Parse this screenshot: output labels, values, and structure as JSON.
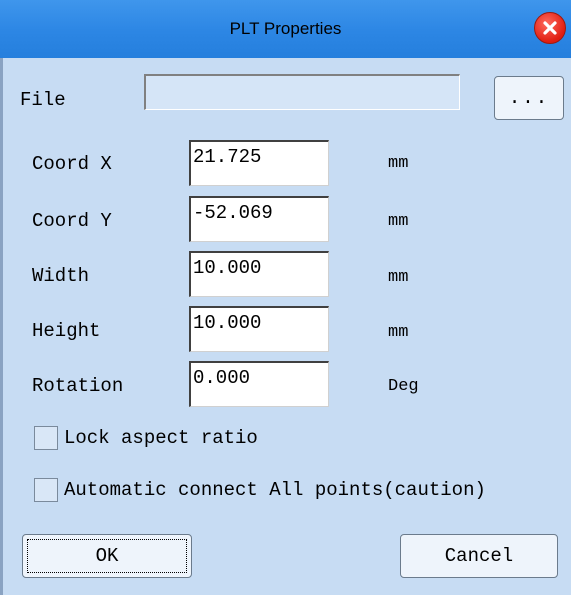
{
  "window": {
    "title": "PLT Properties",
    "close_icon": "close-icon",
    "accent_color": "#2c86e4",
    "background_color": "#c7dcf3"
  },
  "file": {
    "label": "File",
    "value": "",
    "browse_label": "..."
  },
  "fields": {
    "coord_x": {
      "label": "Coord X",
      "value": "21.725",
      "unit": "mm"
    },
    "coord_y": {
      "label": "Coord Y",
      "value": "-52.069",
      "unit": "mm"
    },
    "width": {
      "label": "Width",
      "value": "10.000",
      "unit": "mm"
    },
    "height": {
      "label": "Height",
      "value": "10.000",
      "unit": "mm"
    },
    "rotation": {
      "label": "Rotation",
      "value": "0.000",
      "unit": "Deg"
    }
  },
  "options": {
    "lock_aspect": {
      "label": "Lock aspect ratio",
      "checked": false
    },
    "auto_connect": {
      "label": "Automatic connect All points(caution)",
      "checked": false
    }
  },
  "buttons": {
    "ok": "OK",
    "cancel": "Cancel"
  }
}
